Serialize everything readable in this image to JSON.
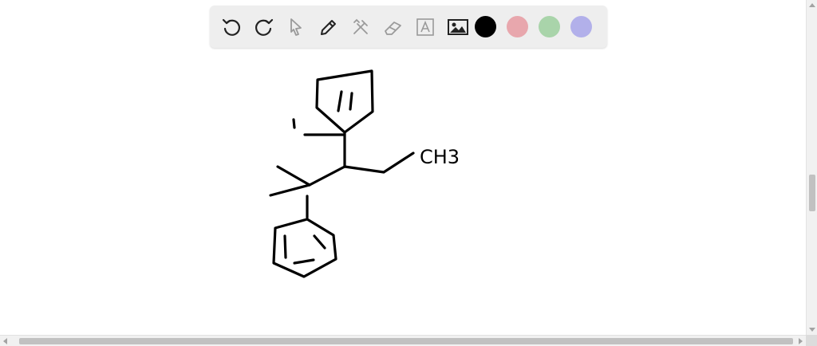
{
  "toolbar": {
    "tools": [
      {
        "icon": "undo-icon",
        "enabled": true
      },
      {
        "icon": "redo-icon",
        "enabled": true
      },
      {
        "icon": "select-pointer-icon",
        "enabled": false
      },
      {
        "icon": "pen-icon",
        "enabled": true
      },
      {
        "icon": "tools-icon",
        "enabled": false
      },
      {
        "icon": "eraser-icon",
        "enabled": false
      },
      {
        "icon": "text-icon",
        "enabled": false
      },
      {
        "icon": "image-icon",
        "enabled": true
      }
    ],
    "colors": [
      {
        "name": "black",
        "hex": "#000000",
        "selected": true
      },
      {
        "name": "red",
        "hex": "#e8a7ad"
      },
      {
        "name": "green",
        "hex": "#a9d4aa"
      },
      {
        "name": "blue",
        "hex": "#b2b0ea"
      }
    ]
  },
  "drawing": {
    "stroke_color": "#000000",
    "label": "CH3"
  },
  "scrollbars": {
    "track": "#f1f1f1",
    "thumb": "#c1c1c1"
  }
}
